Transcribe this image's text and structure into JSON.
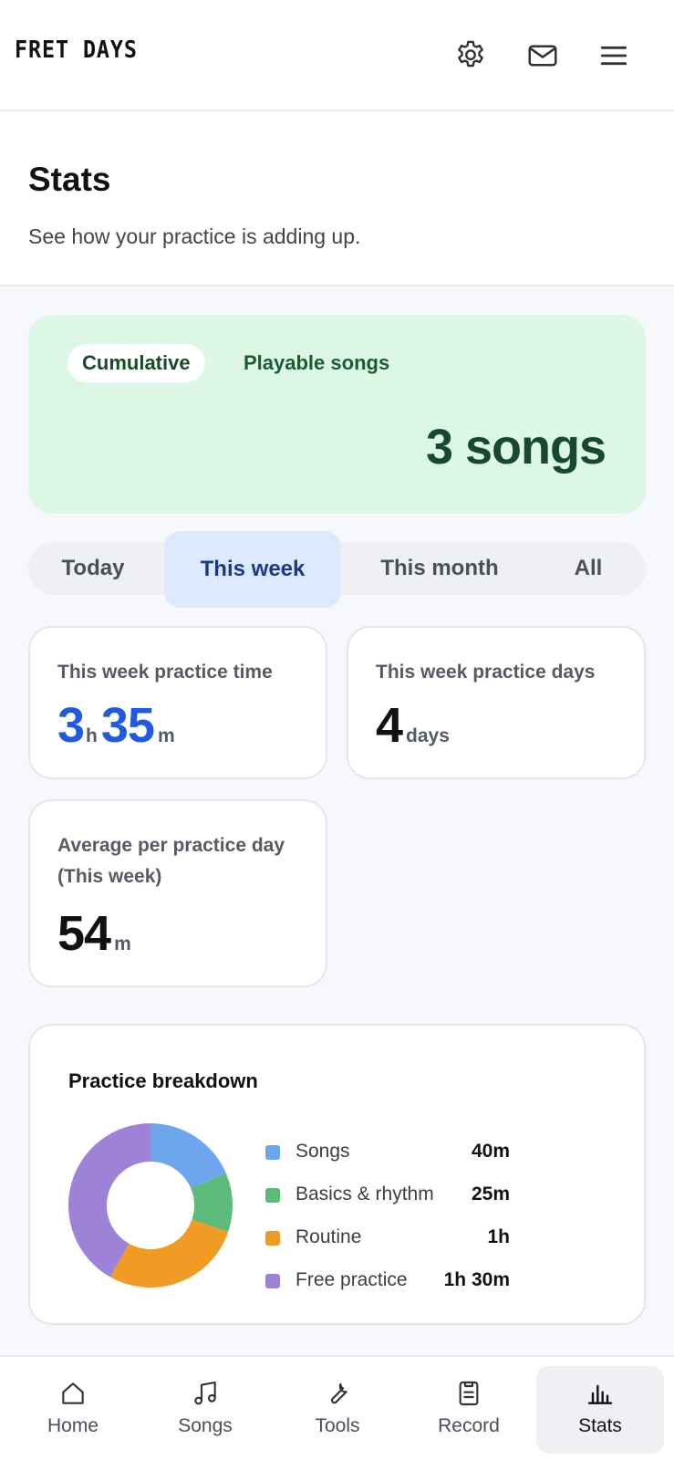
{
  "app": {
    "brand": "FRET DAYS"
  },
  "header": {
    "title": "Stats",
    "subtitle": "See how your practice is adding up."
  },
  "hero": {
    "pill": "Cumulative",
    "label": "Playable songs",
    "value": "3 songs"
  },
  "tabs": [
    {
      "label": "Today"
    },
    {
      "label": "This week"
    },
    {
      "label": "This month"
    },
    {
      "label": "All"
    }
  ],
  "selected_tab": "This week",
  "cards": {
    "time": {
      "label": "This week practice time",
      "hours": "3",
      "hours_unit": "h",
      "minutes": "35",
      "minutes_unit": "m"
    },
    "days": {
      "label": "This week practice days",
      "value": "4",
      "unit": "days"
    },
    "avg": {
      "label": "Average per practice day (This week)",
      "value": "54",
      "unit": "m"
    }
  },
  "breakdown": {
    "title": "Practice breakdown",
    "items": [
      {
        "label": "Songs",
        "value": "40m",
        "minutes": 40,
        "color": "#6ea6ee"
      },
      {
        "label": "Basics & rhythm",
        "value": "25m",
        "minutes": 25,
        "color": "#5cba7a"
      },
      {
        "label": "Routine",
        "value": "1h",
        "minutes": 60,
        "color": "#ef9b24"
      },
      {
        "label": "Free practice",
        "value": "1h 30m",
        "minutes": 90,
        "color": "#9d82d8"
      }
    ]
  },
  "nav": [
    {
      "label": "Home",
      "icon": "home-icon"
    },
    {
      "label": "Songs",
      "icon": "music-note-icon"
    },
    {
      "label": "Tools",
      "icon": "wrench-icon"
    },
    {
      "label": "Record",
      "icon": "clipboard-icon"
    },
    {
      "label": "Stats",
      "icon": "bar-chart-icon"
    }
  ],
  "active_nav": "Stats",
  "colors": {
    "accent_blue": "#1f5ae0",
    "hero_bg": "#dcf8e4",
    "hero_text": "#17492a",
    "tab_active_bg": "#dde9fd"
  }
}
